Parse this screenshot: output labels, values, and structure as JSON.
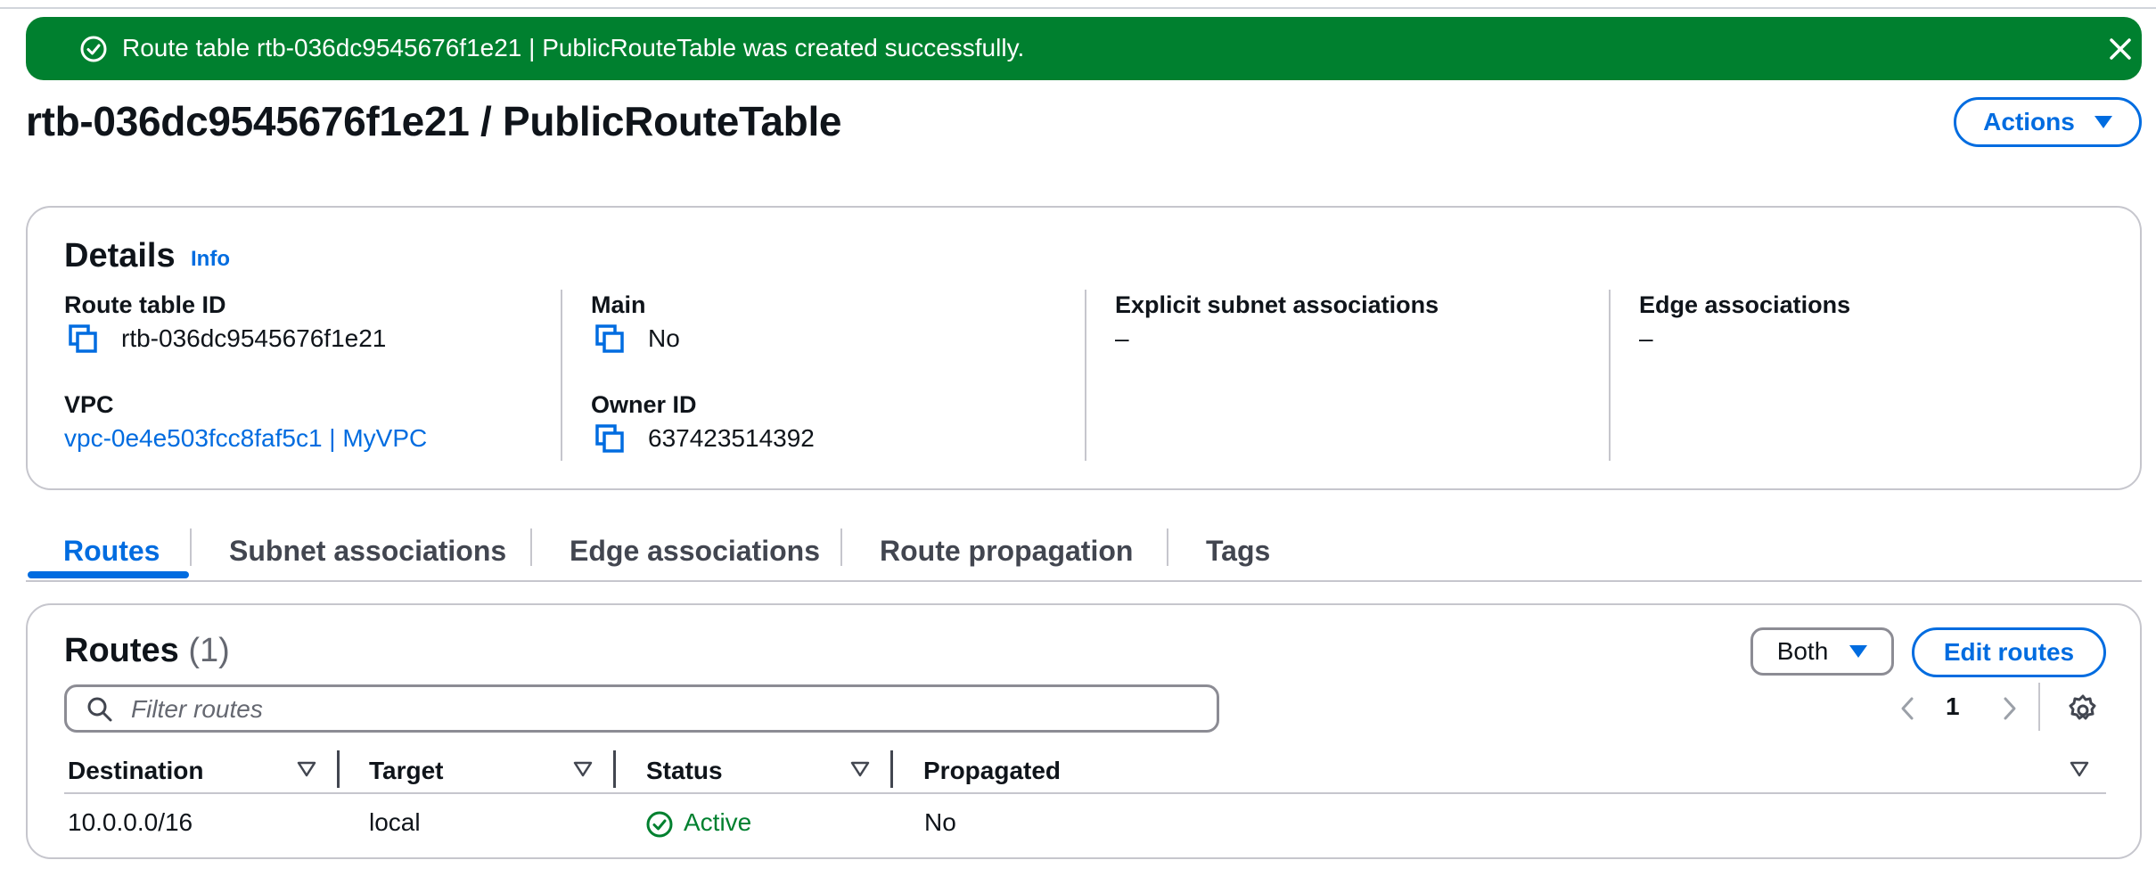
{
  "flash": {
    "message": "Route table rtb-036dc9545676f1e21 | PublicRouteTable was created successfully.",
    "color": "#00802f"
  },
  "header": {
    "title": "rtb-036dc9545676f1e21 / PublicRouteTable",
    "actions_label": "Actions"
  },
  "details": {
    "title": "Details",
    "info_label": "Info",
    "route_table_id": {
      "label": "Route table ID",
      "value": "rtb-036dc9545676f1e21"
    },
    "vpc": {
      "label": "VPC",
      "value": "vpc-0e4e503fcc8faf5c1 | MyVPC"
    },
    "main": {
      "label": "Main",
      "value": "No"
    },
    "owner_id": {
      "label": "Owner ID",
      "value": "637423514392"
    },
    "explicit_subnet": {
      "label": "Explicit subnet associations",
      "value": "–"
    },
    "edge": {
      "label": "Edge associations",
      "value": "–"
    }
  },
  "tabs": [
    {
      "label": "Routes"
    },
    {
      "label": "Subnet associations"
    },
    {
      "label": "Edge associations"
    },
    {
      "label": "Route propagation"
    },
    {
      "label": "Tags"
    }
  ],
  "routes": {
    "title": "Routes",
    "count": "(1)",
    "both_label": "Both",
    "edit_label": "Edit routes",
    "filter_placeholder": "Filter routes",
    "page": "1",
    "columns": [
      "Destination",
      "Target",
      "Status",
      "Propagated"
    ],
    "rows": [
      {
        "destination": "10.0.0.0/16",
        "target": "local",
        "status": "Active",
        "propagated": "No"
      }
    ]
  },
  "colors": {
    "accent": "#006ce0",
    "success": "#00802f",
    "border": "#c6c6cd"
  }
}
